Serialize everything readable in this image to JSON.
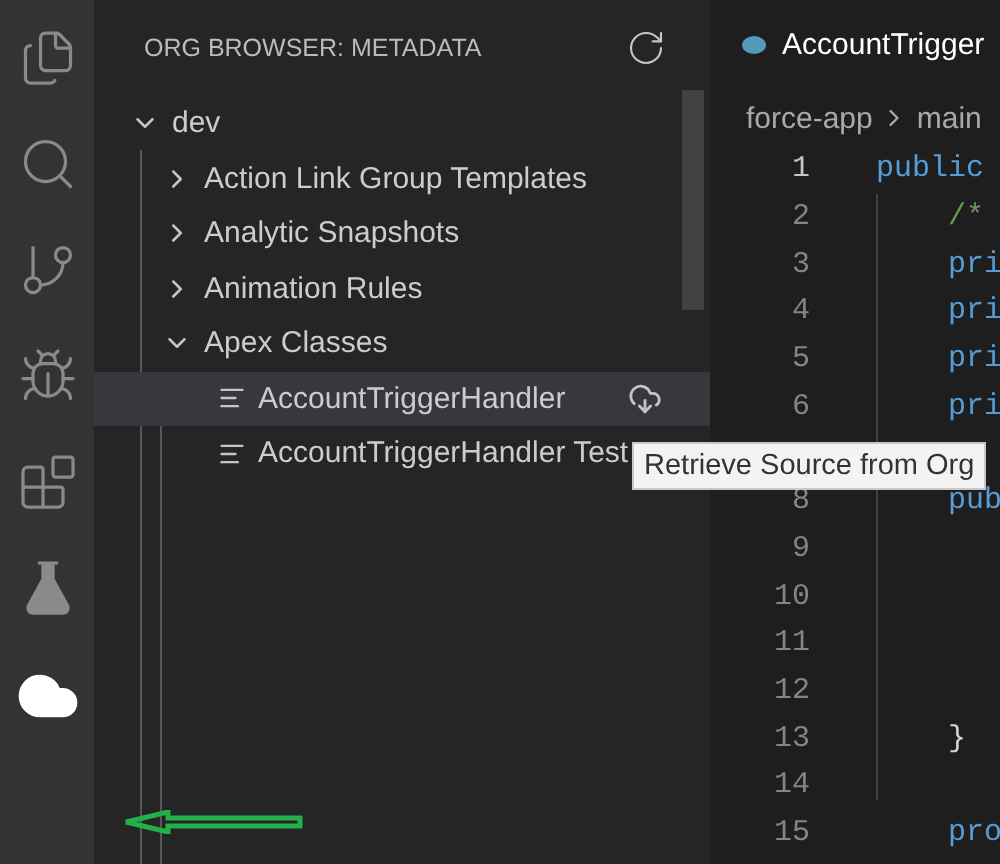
{
  "sidebar": {
    "title": "ORG BROWSER: METADATA",
    "tree": [
      {
        "label": "dev",
        "kind": "folder",
        "expanded": true,
        "children": [
          {
            "label": "Action Link Group Templates",
            "kind": "folder",
            "expanded": false
          },
          {
            "label": "Analytic Snapshots",
            "kind": "folder",
            "expanded": false
          },
          {
            "label": "Animation Rules",
            "kind": "folder",
            "expanded": false
          },
          {
            "label": "Apex Classes",
            "kind": "folder",
            "expanded": true,
            "children": [
              {
                "label": "AccountTriggerHandler",
                "kind": "class",
                "selected": true
              },
              {
                "label": "AccountTriggerHandler Test",
                "kind": "class",
                "selected": false
              }
            ]
          }
        ]
      }
    ]
  },
  "tooltip": "Retrieve Source from Org",
  "editor": {
    "tab": "AccountTrigger",
    "breadcrumb": [
      "force-app",
      "main"
    ],
    "lines": [
      {
        "number": "1",
        "active": true,
        "code": "public",
        "kind": "keyword"
      },
      {
        "number": "2",
        "active": false,
        "code": "    /*",
        "kind": "comment"
      },
      {
        "number": "3",
        "active": false,
        "code": "    pri",
        "kind": "keyword"
      },
      {
        "number": "4",
        "active": false,
        "code": "    pri",
        "kind": "keyword"
      },
      {
        "number": "5",
        "active": false,
        "code": "    pri",
        "kind": "keyword"
      },
      {
        "number": "6",
        "active": false,
        "code": "    pri",
        "kind": "keyword"
      },
      {
        "kind": "covered"
      },
      {
        "number": "8",
        "active": false,
        "code": "    pub",
        "kind": "keyword"
      },
      {
        "number": "9",
        "active": false
      },
      {
        "number": "10",
        "active": false
      },
      {
        "number": "11",
        "active": false
      },
      {
        "number": "12",
        "active": false
      },
      {
        "number": "13",
        "active": false,
        "code": "    }",
        "kind": "punct"
      },
      {
        "number": "14",
        "active": false
      },
      {
        "number": "15",
        "active": false,
        "code": "    pro",
        "kind": "keyword"
      }
    ]
  }
}
